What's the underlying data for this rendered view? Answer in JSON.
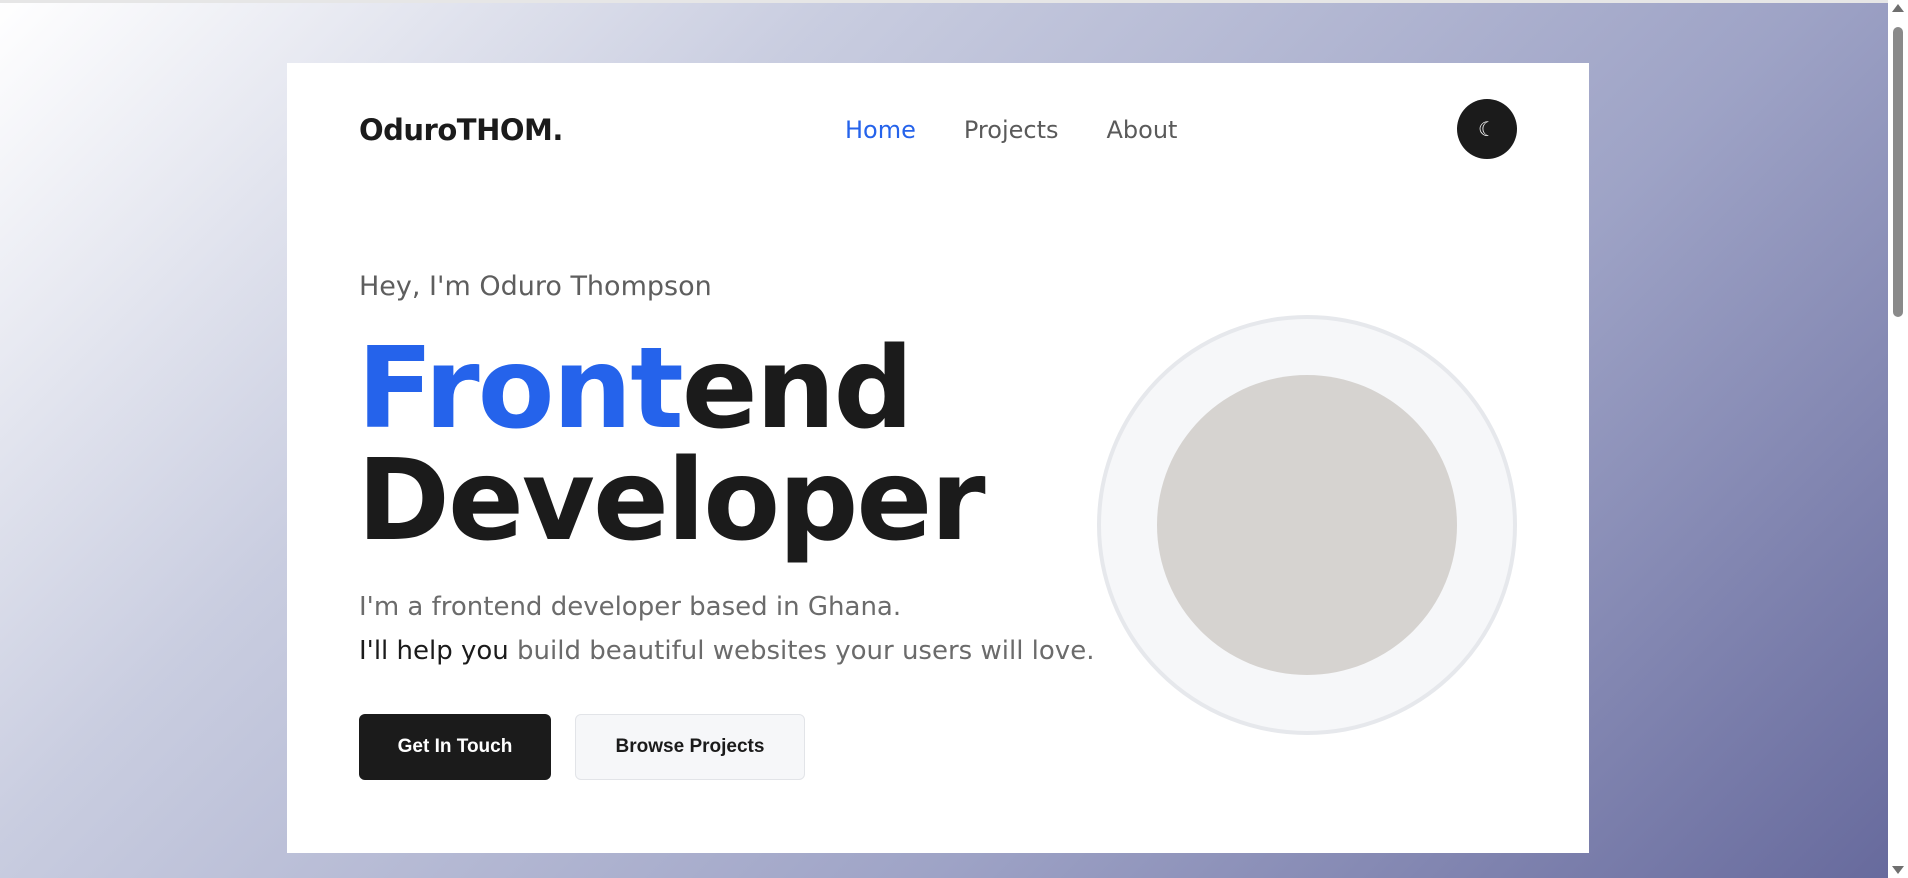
{
  "header": {
    "logo": "OduroTHOM.",
    "nav": [
      {
        "label": "Home",
        "active": true
      },
      {
        "label": "Projects",
        "active": false
      },
      {
        "label": "About",
        "active": false
      }
    ],
    "theme_toggle_icon": "☾"
  },
  "hero": {
    "greeting": "Hey, I'm Oduro Thompson",
    "headline_accent": "Front",
    "headline_rest": "end",
    "headline_line2": "Developer",
    "desc_line1": "I'm a frontend developer based in Ghana.",
    "desc_line2_dark": "I'll help you",
    "desc_line2_rest": " build beautiful websites your users will love.",
    "primary_button": "Get In Touch",
    "secondary_button": "Browse Projects"
  },
  "colors": {
    "accent": "#2563eb",
    "dark": "#1b1b1b",
    "avatar_placeholder": "#d6d3d0"
  },
  "icons": {
    "theme": "moon-icon"
  }
}
